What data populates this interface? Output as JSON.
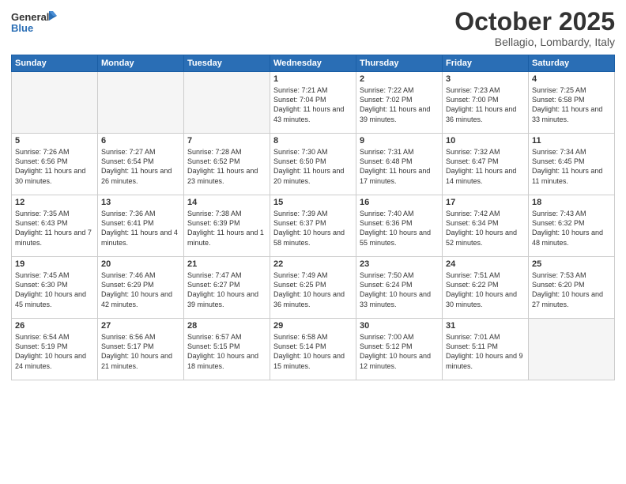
{
  "header": {
    "logo_general": "General",
    "logo_blue": "Blue",
    "month_title": "October 2025",
    "location": "Bellagio, Lombardy, Italy"
  },
  "days_of_week": [
    "Sunday",
    "Monday",
    "Tuesday",
    "Wednesday",
    "Thursday",
    "Friday",
    "Saturday"
  ],
  "weeks": [
    [
      {
        "day": "",
        "info": ""
      },
      {
        "day": "",
        "info": ""
      },
      {
        "day": "",
        "info": ""
      },
      {
        "day": "1",
        "info": "Sunrise: 7:21 AM\nSunset: 7:04 PM\nDaylight: 11 hours\nand 43 minutes."
      },
      {
        "day": "2",
        "info": "Sunrise: 7:22 AM\nSunset: 7:02 PM\nDaylight: 11 hours\nand 39 minutes."
      },
      {
        "day": "3",
        "info": "Sunrise: 7:23 AM\nSunset: 7:00 PM\nDaylight: 11 hours\nand 36 minutes."
      },
      {
        "day": "4",
        "info": "Sunrise: 7:25 AM\nSunset: 6:58 PM\nDaylight: 11 hours\nand 33 minutes."
      }
    ],
    [
      {
        "day": "5",
        "info": "Sunrise: 7:26 AM\nSunset: 6:56 PM\nDaylight: 11 hours\nand 30 minutes."
      },
      {
        "day": "6",
        "info": "Sunrise: 7:27 AM\nSunset: 6:54 PM\nDaylight: 11 hours\nand 26 minutes."
      },
      {
        "day": "7",
        "info": "Sunrise: 7:28 AM\nSunset: 6:52 PM\nDaylight: 11 hours\nand 23 minutes."
      },
      {
        "day": "8",
        "info": "Sunrise: 7:30 AM\nSunset: 6:50 PM\nDaylight: 11 hours\nand 20 minutes."
      },
      {
        "day": "9",
        "info": "Sunrise: 7:31 AM\nSunset: 6:48 PM\nDaylight: 11 hours\nand 17 minutes."
      },
      {
        "day": "10",
        "info": "Sunrise: 7:32 AM\nSunset: 6:47 PM\nDaylight: 11 hours\nand 14 minutes."
      },
      {
        "day": "11",
        "info": "Sunrise: 7:34 AM\nSunset: 6:45 PM\nDaylight: 11 hours\nand 11 minutes."
      }
    ],
    [
      {
        "day": "12",
        "info": "Sunrise: 7:35 AM\nSunset: 6:43 PM\nDaylight: 11 hours\nand 7 minutes."
      },
      {
        "day": "13",
        "info": "Sunrise: 7:36 AM\nSunset: 6:41 PM\nDaylight: 11 hours\nand 4 minutes."
      },
      {
        "day": "14",
        "info": "Sunrise: 7:38 AM\nSunset: 6:39 PM\nDaylight: 11 hours\nand 1 minute."
      },
      {
        "day": "15",
        "info": "Sunrise: 7:39 AM\nSunset: 6:37 PM\nDaylight: 10 hours\nand 58 minutes."
      },
      {
        "day": "16",
        "info": "Sunrise: 7:40 AM\nSunset: 6:36 PM\nDaylight: 10 hours\nand 55 minutes."
      },
      {
        "day": "17",
        "info": "Sunrise: 7:42 AM\nSunset: 6:34 PM\nDaylight: 10 hours\nand 52 minutes."
      },
      {
        "day": "18",
        "info": "Sunrise: 7:43 AM\nSunset: 6:32 PM\nDaylight: 10 hours\nand 48 minutes."
      }
    ],
    [
      {
        "day": "19",
        "info": "Sunrise: 7:45 AM\nSunset: 6:30 PM\nDaylight: 10 hours\nand 45 minutes."
      },
      {
        "day": "20",
        "info": "Sunrise: 7:46 AM\nSunset: 6:29 PM\nDaylight: 10 hours\nand 42 minutes."
      },
      {
        "day": "21",
        "info": "Sunrise: 7:47 AM\nSunset: 6:27 PM\nDaylight: 10 hours\nand 39 minutes."
      },
      {
        "day": "22",
        "info": "Sunrise: 7:49 AM\nSunset: 6:25 PM\nDaylight: 10 hours\nand 36 minutes."
      },
      {
        "day": "23",
        "info": "Sunrise: 7:50 AM\nSunset: 6:24 PM\nDaylight: 10 hours\nand 33 minutes."
      },
      {
        "day": "24",
        "info": "Sunrise: 7:51 AM\nSunset: 6:22 PM\nDaylight: 10 hours\nand 30 minutes."
      },
      {
        "day": "25",
        "info": "Sunrise: 7:53 AM\nSunset: 6:20 PM\nDaylight: 10 hours\nand 27 minutes."
      }
    ],
    [
      {
        "day": "26",
        "info": "Sunrise: 6:54 AM\nSunset: 5:19 PM\nDaylight: 10 hours\nand 24 minutes."
      },
      {
        "day": "27",
        "info": "Sunrise: 6:56 AM\nSunset: 5:17 PM\nDaylight: 10 hours\nand 21 minutes."
      },
      {
        "day": "28",
        "info": "Sunrise: 6:57 AM\nSunset: 5:15 PM\nDaylight: 10 hours\nand 18 minutes."
      },
      {
        "day": "29",
        "info": "Sunrise: 6:58 AM\nSunset: 5:14 PM\nDaylight: 10 hours\nand 15 minutes."
      },
      {
        "day": "30",
        "info": "Sunrise: 7:00 AM\nSunset: 5:12 PM\nDaylight: 10 hours\nand 12 minutes."
      },
      {
        "day": "31",
        "info": "Sunrise: 7:01 AM\nSunset: 5:11 PM\nDaylight: 10 hours\nand 9 minutes."
      },
      {
        "day": "",
        "info": ""
      }
    ]
  ]
}
